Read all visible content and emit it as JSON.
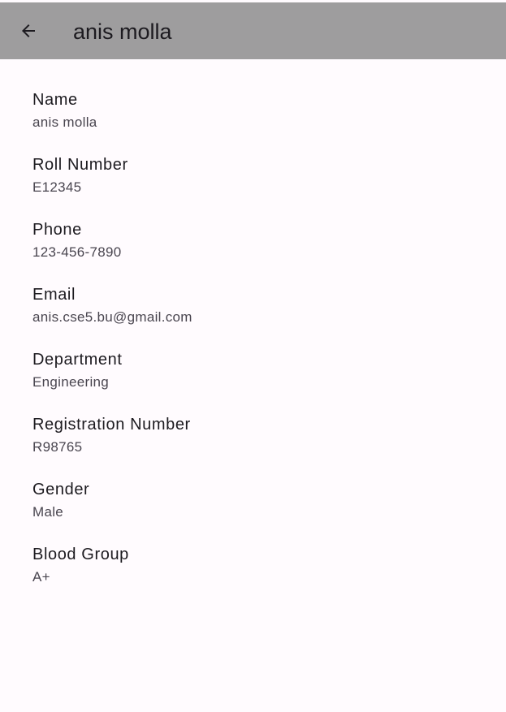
{
  "app_bar": {
    "title": "anis molla",
    "back_icon": "arrow-back-icon",
    "background_color": "#9e9d9e"
  },
  "fields": [
    {
      "label": "Name",
      "value": "anis molla"
    },
    {
      "label": "Roll Number",
      "value": "E12345"
    },
    {
      "label": "Phone",
      "value": "123-456-7890"
    },
    {
      "label": "Email",
      "value": "anis.cse5.bu@gmail.com"
    },
    {
      "label": "Department",
      "value": "Engineering"
    },
    {
      "label": "Registration Number",
      "value": "R98765"
    },
    {
      "label": "Gender",
      "value": "Male"
    },
    {
      "label": "Blood Group",
      "value": "A+"
    }
  ]
}
